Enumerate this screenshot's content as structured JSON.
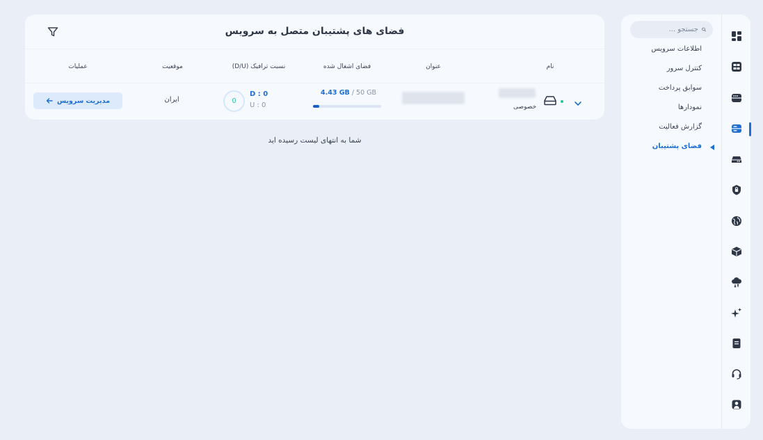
{
  "page": {
    "title": "فضای های پشتیبان متصل به سرویس",
    "end_of_list": "شما به انتهای لیست رسیده اید"
  },
  "search": {
    "placeholder": "جستجو ..."
  },
  "subnav": {
    "items": [
      {
        "label": "اطلاعات سرویس"
      },
      {
        "label": "کنترل سرور"
      },
      {
        "label": "سوابق پرداخت"
      },
      {
        "label": "نمودارها"
      },
      {
        "label": "گزارش فعالیت"
      },
      {
        "label": "فضای پشتیبان",
        "active": true
      }
    ]
  },
  "rail": {
    "icons": [
      "dashboard-icon",
      "server-info-icon",
      "servers-icon",
      "backup-storage-icon",
      "cloud-server-icon",
      "shield-icon",
      "globe-icon",
      "package-icon",
      "cloud-transfer-icon",
      "sparkle-icon",
      "invoice-icon",
      "support-headset-icon",
      "user-account-icon"
    ],
    "active_index": 3
  },
  "table": {
    "headers": {
      "name": "نام",
      "title": "عنوان",
      "used_space": "فضای اشغال شده",
      "traffic_ratio": "نسبت ترافیک (D/U)",
      "location": "موقعیت",
      "actions": "عملیات"
    },
    "rows": [
      {
        "type": "خصوصی",
        "used": "4.43 GB",
        "separator": " / ",
        "total": "50 GB",
        "usage_fraction": 0.0886,
        "ratio": "0",
        "download": "D : 0",
        "upload": "U : 0",
        "location": "ایران",
        "action_label": "مدیریت سرویس"
      }
    ]
  },
  "colors": {
    "accent": "#1e6fd1",
    "status_online": "#22c39a"
  }
}
